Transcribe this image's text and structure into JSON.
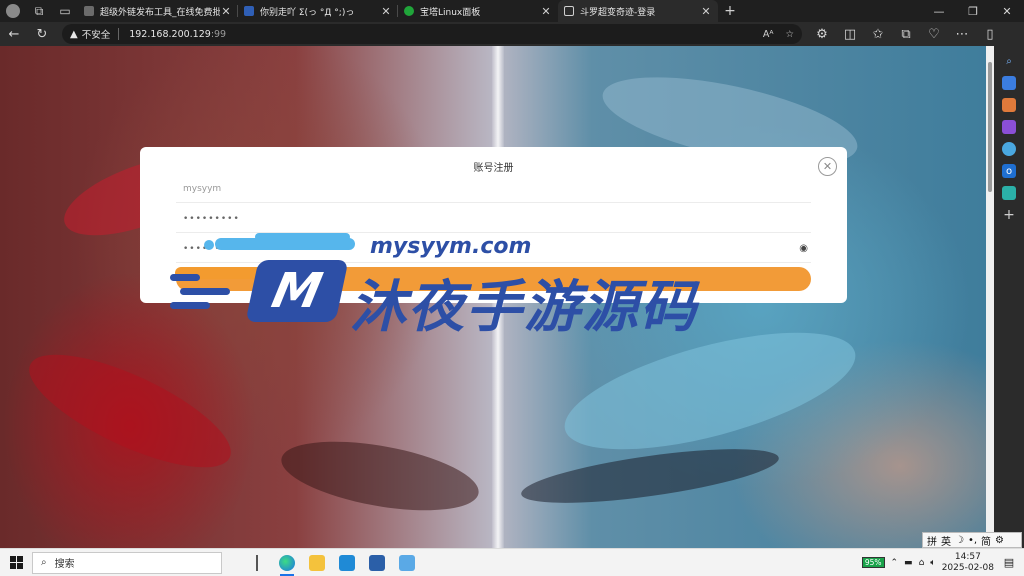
{
  "browser": {
    "tabs": [
      {
        "title": "超级外链发布工具_在线免费批量",
        "icon_color": "#6b6b6b",
        "active": false
      },
      {
        "title": "你别走吖 Σ(っ °Д °;)っ",
        "icon_color": "#2f5fb6",
        "active": false
      },
      {
        "title": "宝塔Linux面板",
        "icon_color": "#20a53a",
        "active": false
      },
      {
        "title": "斗罗超变奇迹-登录",
        "icon_color": "#cfcfcf",
        "active": true
      }
    ],
    "address": {
      "insecure_label": "不安全",
      "host": "192.168.200.129",
      "port": ":99"
    },
    "icons": {
      "back": "back-arrow-icon",
      "refresh": "refresh-icon",
      "new_tab": "plus-icon",
      "read_aloud": "read-aloud-icon",
      "favorite": "star-icon"
    }
  },
  "modal": {
    "title": "账号注册",
    "username_value": "mysyym",
    "password_value": "•••••••••",
    "confirm_value": "•••••••••",
    "close_icon": "close-icon",
    "eye_icon": "eye-icon"
  },
  "watermark": {
    "url": "mysyym.com",
    "m_letter": "M",
    "cn_text": "沐夜手游源码"
  },
  "taskbar": {
    "search_placeholder": "搜索",
    "battery": "95%",
    "time": "14:57",
    "date": "2025-02-08"
  },
  "ime": {
    "mode": "拼",
    "lang": "英",
    "moon": "☽",
    "dot": "•,",
    "simp": "简"
  },
  "colors": {
    "brand_blue": "#2d4fa6",
    "brand_light_blue": "#56b6ec",
    "brand_orange": "#f39b2f"
  }
}
